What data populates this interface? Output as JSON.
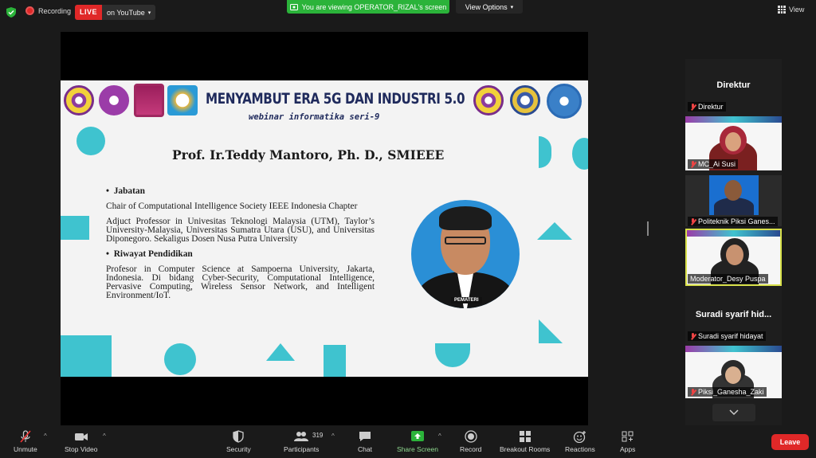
{
  "topbar": {
    "recording_label": "Recording",
    "live_label": "LIVE",
    "youtube_label": "on YouTube",
    "viewing_label": "You are viewing OPERATOR_RIZAL's screen",
    "view_options_label": "View Options",
    "view_label": "View"
  },
  "slide": {
    "title": "MENYAMBUT ERA 5G DAN INDUSTRI 5.0",
    "subtitle": "webinar informatika seri-9",
    "speaker": "Prof. Ir.Teddy Mantoro, Ph. D., SMIEEE",
    "jabatan_heading": "Jabatan",
    "jabatan_1": "Chair of Computational Intelligence Society IEEE Indonesia Chapter",
    "jabatan_2": "Adjuct Professor in Univesitas Teknologi Malaysia (UTM), Taylor’s University-Malaysia, Universitas Sumatra Utara (USU), and Universitas Diponegoro. Sekaligus Dosen Nusa Putra University",
    "pendidikan_heading": "Riwayat Pendidikan",
    "pendidikan_1": "Profesor in Computer Science at Sampoerna University, Jakarta, Indonesia. Di bidang Cyber-Security, Computational Intelligence, Pervasive Computing, Wireless Sensor Network, and Intelligent Environment/IoT.",
    "photo_badge": "PEMATERI"
  },
  "gallery": {
    "tiles": [
      {
        "title": "Direktur",
        "name": "Direktur"
      },
      {
        "name": "MC_Ai Susi"
      },
      {
        "name": "Politeknik Piksi Ganes..."
      },
      {
        "name": "Moderator_Desy Puspa"
      },
      {
        "title": "Suradi syarif hid...",
        "name": "Suradi syarif hidayat"
      },
      {
        "name": "Piksi_Ganesha_Zaki"
      }
    ]
  },
  "toolbar": {
    "unmute": "Unmute",
    "stop_video": "Stop Video",
    "security": "Security",
    "participants": "Participants",
    "participants_count": "319",
    "chat": "Chat",
    "share_screen": "Share Screen",
    "record": "Record",
    "breakout": "Breakout Rooms",
    "reactions": "Reactions",
    "apps": "Apps",
    "leave": "Leave"
  },
  "colors": {
    "live": "#e02828",
    "viewing_banner": "#2bb33a",
    "slide_accent": "#3fc3cf",
    "active_speaker_border": "#d8e04a"
  }
}
